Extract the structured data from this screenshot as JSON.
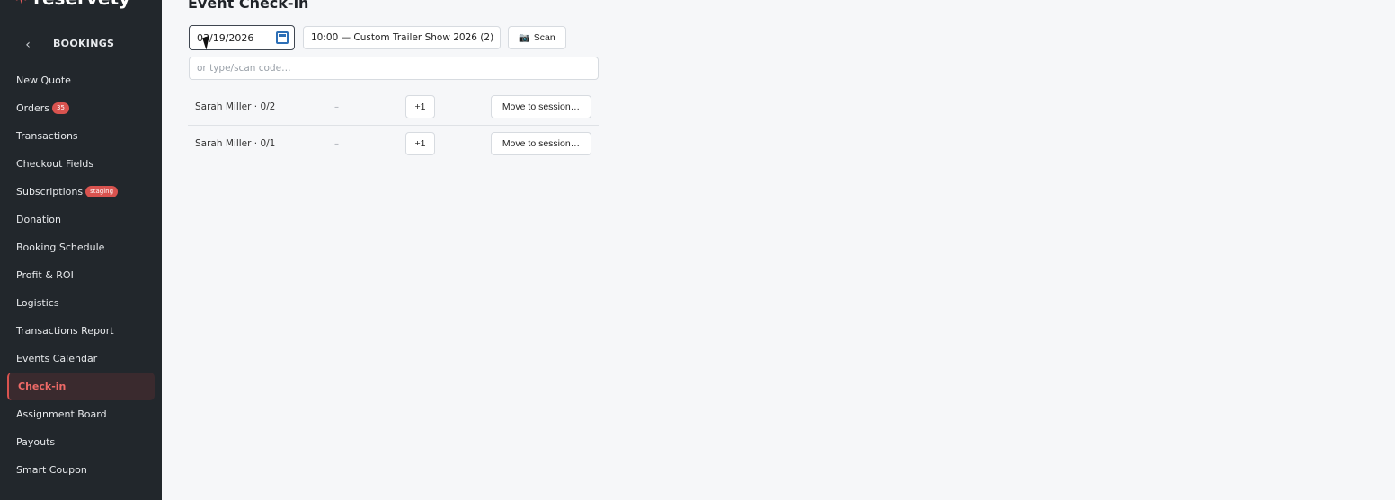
{
  "sidebar": {
    "brand": "reservety",
    "section_title": "BOOKINGS",
    "items": [
      {
        "label": "New Quote"
      },
      {
        "label": "Orders",
        "badge": "35"
      },
      {
        "label": "Transactions"
      },
      {
        "label": "Checkout Fields"
      },
      {
        "label": "Subscriptions",
        "badge": "staging"
      },
      {
        "label": "Donation"
      },
      {
        "label": "Booking Schedule"
      },
      {
        "label": "Profit & ROI"
      },
      {
        "label": "Logistics"
      },
      {
        "label": "Transactions Report"
      },
      {
        "label": "Events Calendar"
      },
      {
        "label": "Check-in",
        "active": true
      },
      {
        "label": "Assignment Board"
      },
      {
        "label": "Payouts"
      },
      {
        "label": "Smart Coupon"
      }
    ]
  },
  "main": {
    "title": "Event Check-in",
    "date_value": "03/19/2026",
    "session_value": "10:00 — Custom Trailer Show 2026 (2)",
    "scan_label": "Scan",
    "code_placeholder": "or type/scan code…",
    "rows": [
      {
        "name": "Sarah Miller · 0/2",
        "dash": "–",
        "plus_label": "+1",
        "move_label": "Move to session…"
      },
      {
        "name": "Sarah Miller · 0/1",
        "dash": "–",
        "plus_label": "+1",
        "move_label": "Move to session…"
      }
    ]
  },
  "colors": {
    "sidebar_bg": "#22272c",
    "accent": "#d9534f",
    "page_bg": "#f6f7f9"
  }
}
